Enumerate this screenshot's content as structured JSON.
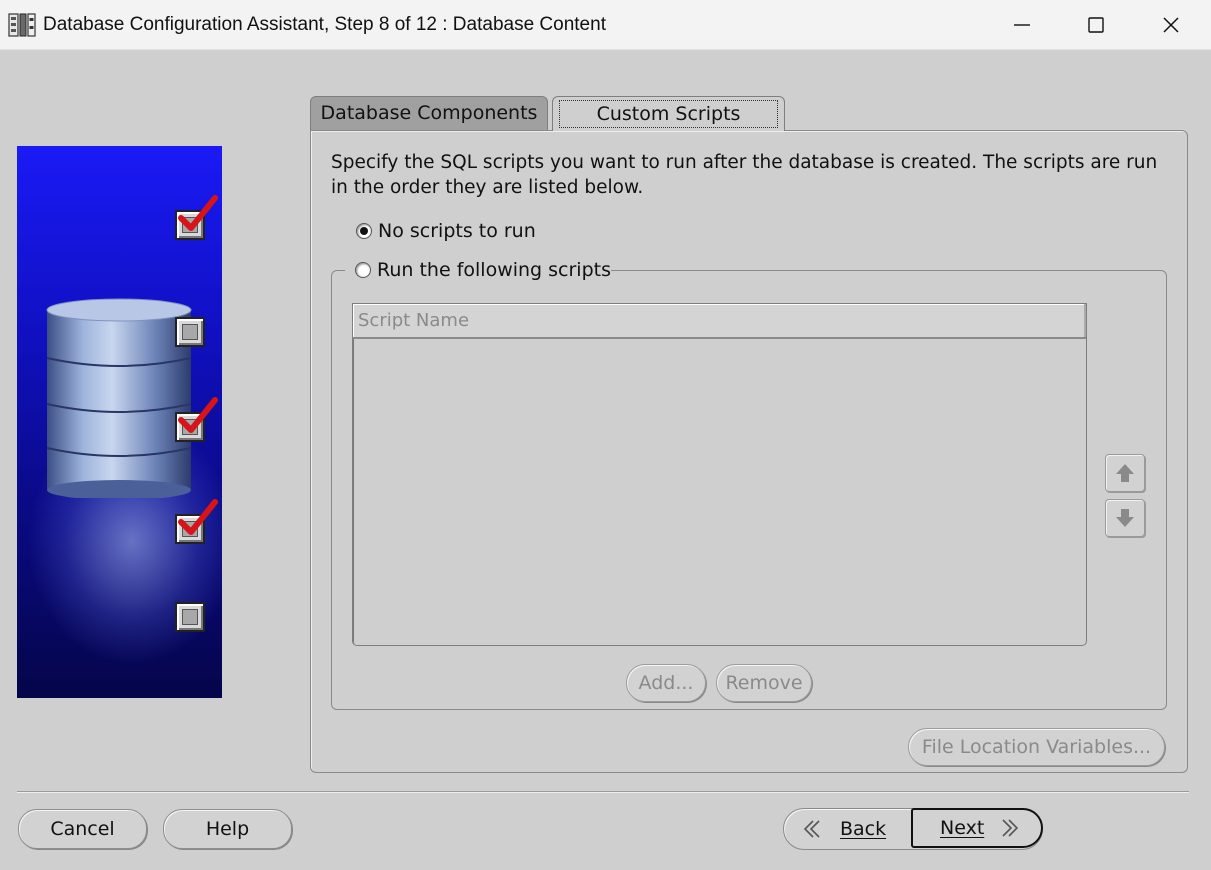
{
  "window": {
    "title": "Database Configuration Assistant, Step 8 of 12 : Database Content",
    "app_icon": "database-app-icon",
    "controls": [
      "minimize-icon",
      "maximize-icon",
      "close-icon"
    ]
  },
  "banner": {
    "image": "database-cylinder-graphic",
    "steps": [
      {
        "state": "checked"
      },
      {
        "state": "unchecked"
      },
      {
        "state": "checked"
      },
      {
        "state": "checked"
      },
      {
        "state": "unchecked"
      }
    ]
  },
  "tabs": [
    {
      "label": "Database Components",
      "selected": false
    },
    {
      "label": "Custom Scripts",
      "selected": true
    }
  ],
  "custom_scripts": {
    "description": "Specify the SQL scripts you want to run after the database is created. The scripts are run in the order they are listed below.",
    "option_no_scripts": "No scripts to run",
    "option_run_scripts": "Run the following scripts",
    "selected_option": "No scripts to run",
    "table": {
      "columns": [
        "Script Name"
      ],
      "rows": []
    },
    "move_up_icon": "arrow-up-icon",
    "move_down_icon": "arrow-down-icon",
    "add_label": "Add...",
    "remove_label": "Remove",
    "file_location_label": "File Location Variables..."
  },
  "footer": {
    "cancel_label": "Cancel",
    "help_label": "Help",
    "back_label": "Back",
    "next_label": "Next"
  }
}
